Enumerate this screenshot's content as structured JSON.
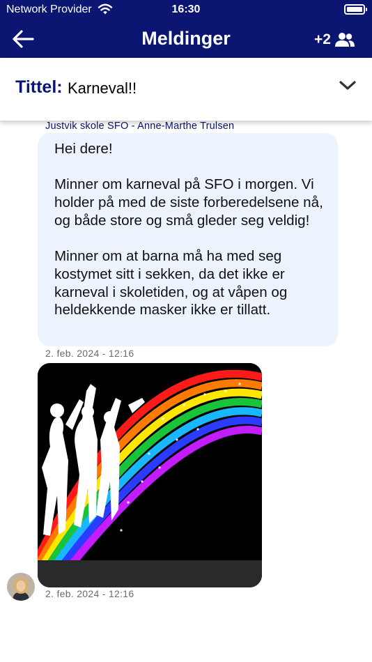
{
  "status_bar": {
    "carrier": "Network Provider",
    "time": "16:30"
  },
  "header": {
    "title": "Meldinger",
    "participants_extra": "+2"
  },
  "thread": {
    "title_label": "Tittel:",
    "title_value": "Karneval!!"
  },
  "messages": [
    {
      "sender": "Justvik skole SFO - Anne-Marthe Trulsen",
      "text": "Hei dere!\n\nMinner om karneval på SFO i morgen. Vi holder på med de siste forberedelsene nå, og både store og små gleder seg veldig!\n\nMinner om at barna må ha med seg kostymet sitt i sekken, da det ikke er karneval i skoletiden, og at våpen og heldekkende masker ikke er tillatt.",
      "timestamp": "2. feb. 2024 - 12:16"
    },
    {
      "type": "image",
      "timestamp": "2. feb. 2024 - 12:16"
    }
  ],
  "colors": {
    "header_bg": "#0b1572",
    "bubble_bg": "#edf3fd",
    "accent_text": "#0b1572"
  },
  "icons": {
    "back": "arrow-left-icon",
    "participants": "group-icon",
    "expand": "chevron-down-icon",
    "wifi": "wifi-icon",
    "battery": "battery-icon"
  }
}
